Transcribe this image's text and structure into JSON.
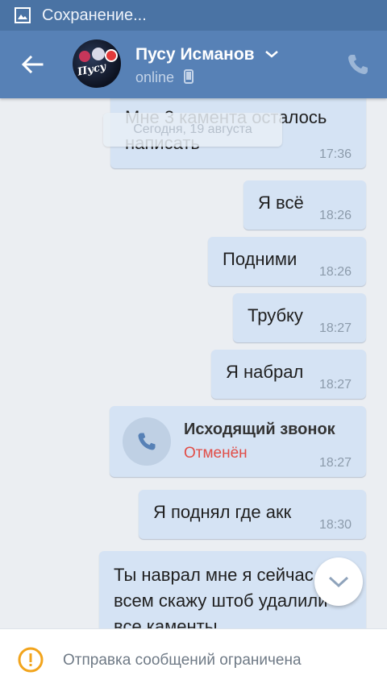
{
  "status_bar": {
    "text": "Сохранение...",
    "icon": "image-icon"
  },
  "header": {
    "contact_name": "Пусу Исманов",
    "status": "online",
    "status_icon": "phone-device-icon",
    "back_icon": "arrow-left-icon",
    "call_icon": "phone-icon",
    "avatar_logo_text": "Пусу"
  },
  "chat": {
    "date_label": "Сегодня, 19 августа",
    "messages": [
      {
        "text_line1": "Мне 3 камента осталось",
        "text_line2": "написать",
        "time": "17:36"
      },
      {
        "text": "Я всё",
        "time": "18:26"
      },
      {
        "text": "Подними",
        "time": "18:26"
      },
      {
        "text": "Трубку",
        "time": "18:27"
      },
      {
        "text": "Я набрал",
        "time": "18:27"
      },
      {
        "type": "call",
        "title": "Исходящий звонок",
        "status": "Отменён",
        "time": "18:27"
      },
      {
        "text": "Я поднял где акк",
        "time": "18:30"
      },
      {
        "text_line1": "Ты наврал мне я сейчас",
        "text_line2": "всем скажу штоб удалили",
        "text_line3": "все каменты"
      }
    ],
    "scroll_down_icon": "chevron-down-icon"
  },
  "footer": {
    "text": "Отправка сообщений ограничена",
    "icon": "warning-icon"
  },
  "colors": {
    "header": "#5781b6",
    "status_bar": "#4a73a4",
    "bubble": "#d5e3f4",
    "background": "#ebeef2",
    "cancel_red": "#e14d47"
  }
}
